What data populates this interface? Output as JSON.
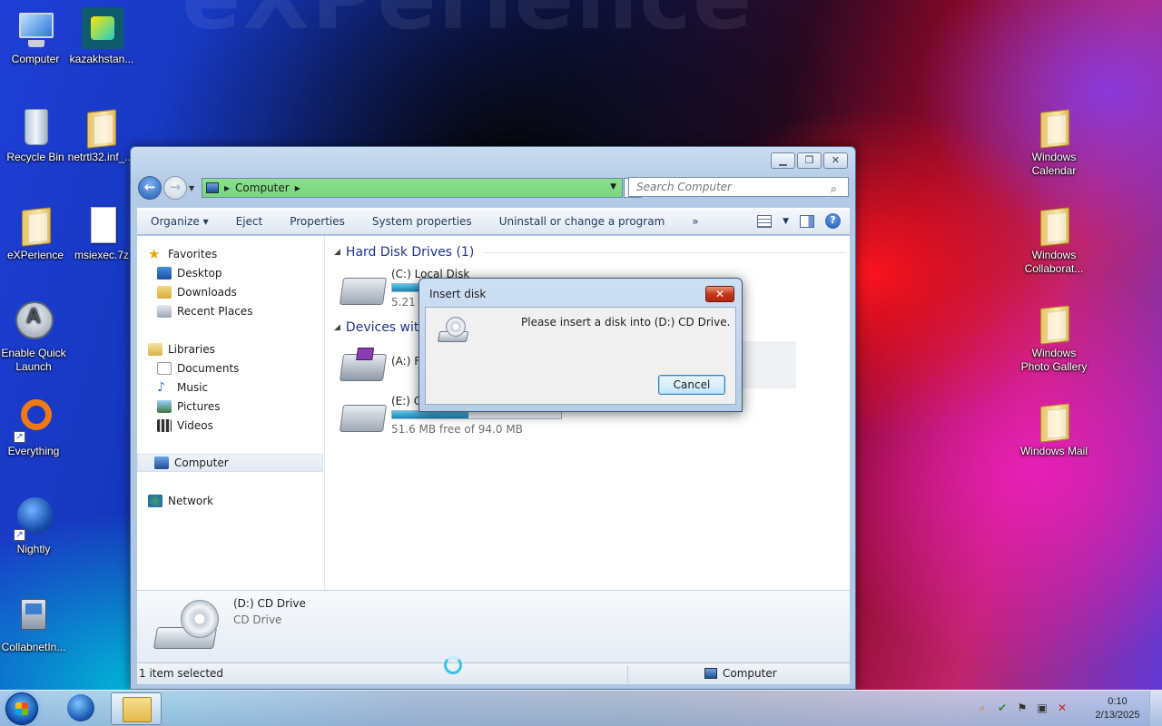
{
  "desktop": {
    "watermark": "eXPerience",
    "icons": [
      {
        "label": "Computer"
      },
      {
        "label": "kazakhstan..."
      },
      {
        "label": "Recycle Bin"
      },
      {
        "label": "netrtl32.inf_..."
      },
      {
        "label": "eXPerience"
      },
      {
        "label": "msiexec.7z"
      },
      {
        "label": "Enable Quick Launch"
      },
      {
        "label": "Everything"
      },
      {
        "label": "Nightly"
      },
      {
        "label": "CollabnetIn..."
      },
      {
        "label": "Windows Calendar"
      },
      {
        "label": "Windows Collaborat..."
      },
      {
        "label": "Windows Photo Gallery"
      },
      {
        "label": "Windows Mail"
      }
    ]
  },
  "explorer": {
    "address": {
      "segment": "Computer"
    },
    "search": {
      "placeholder": "Search Computer"
    },
    "commands": [
      "Organize ▾",
      "Eject",
      "Properties",
      "System properties",
      "Uninstall or change a program",
      "»"
    ],
    "nav": {
      "favorites": "Favorites",
      "desktop": "Desktop",
      "downloads": "Downloads",
      "recent": "Recent Places",
      "libraries": "Libraries",
      "documents": "Documents",
      "music": "Music",
      "pictures": "Pictures",
      "videos": "Videos",
      "computer": "Computer",
      "network": "Network"
    },
    "groups": {
      "hdd": "Hard Disk Drives (1)",
      "removable": "Devices with"
    },
    "drives": [
      {
        "name": "(C:) Local Disk",
        "free": "5.21 G",
        "used_fraction": 0.45
      },
      {
        "name": "(A:) Fl",
        "free": "",
        "used_fraction": 0
      },
      {
        "name": "(E:) CI",
        "free": "51.6 MB free of 94.0 MB",
        "used_fraction": 0.45
      }
    ],
    "details": {
      "title": "(D:) CD Drive",
      "subtitle": "CD Drive"
    },
    "status": {
      "left": "1 item selected",
      "right": "Computer"
    }
  },
  "dialog": {
    "title": "Insert disk",
    "message": "Please insert a disk into (D:) CD Drive.",
    "cancel": "Cancel"
  },
  "taskbar": {
    "time": "0:10",
    "date": "2/13/2025"
  }
}
